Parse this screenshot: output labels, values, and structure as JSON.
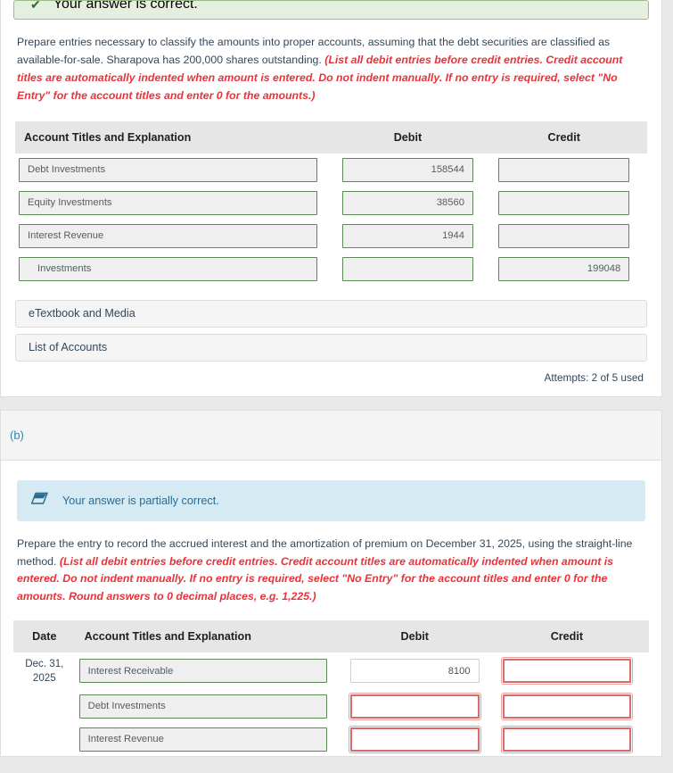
{
  "section_a": {
    "status_banner": {
      "icon": "check-icon",
      "text": "Your answer is correct."
    },
    "prompt": {
      "plain": "Prepare entries necessary to classify the amounts into proper accounts, assuming that the debt securities are classified as available-for-sale. Sharapova has 200,000 shares outstanding. ",
      "italic_red": "(List all debit entries before credit entries. Credit account titles are automatically indented when amount is entered. Do not indent manually. If no entry is required, select \"No Entry\" for the account titles and enter 0 for the amounts.)"
    },
    "table": {
      "headers": {
        "account": "Account Titles and Explanation",
        "debit": "Debit",
        "credit": "Credit"
      },
      "rows": [
        {
          "account": "Debt Investments",
          "indent": false,
          "debit": "158544",
          "credit": ""
        },
        {
          "account": "Equity Investments",
          "indent": false,
          "debit": "38560",
          "credit": ""
        },
        {
          "account": "Interest Revenue",
          "indent": false,
          "debit": "1944",
          "credit": ""
        },
        {
          "account": "Investments",
          "indent": true,
          "debit": "",
          "credit": "199048"
        }
      ]
    },
    "buttons": {
      "etextbook": "eTextbook and Media",
      "list_of_accounts": "List of Accounts"
    },
    "attempts": "Attempts: 2 of 5 used"
  },
  "section_b": {
    "label": "(b)",
    "status_banner": {
      "icon": "partial-icon",
      "text": "Your answer is partially correct."
    },
    "prompt": {
      "plain": "Prepare the entry to record the accrued interest and the amortization of premium on December 31, 2025, using the straight-line method. ",
      "italic_red": "(List all debit entries before credit entries. Credit account titles are automatically indented when amount is entered. Do not indent manually. If no entry is required, select \"No Entry\" for the account titles and enter 0 for the amounts. Round answers to 0 decimal places, e.g. 1,225.)"
    },
    "table": {
      "headers": {
        "date": "Date",
        "account": "Account Titles and Explanation",
        "debit": "Debit",
        "credit": "Credit"
      },
      "rows": [
        {
          "date": "Dec. 31, 2025",
          "account": "Interest Receivable",
          "debit": "8100",
          "credit": "",
          "debit_state": "white",
          "credit_state": "error"
        },
        {
          "date": "",
          "account": "Debt Investments",
          "debit": "",
          "credit": "",
          "debit_state": "error",
          "credit_state": "error"
        },
        {
          "date": "",
          "account": "Interest Revenue",
          "debit": "",
          "credit": "",
          "debit_state": "error",
          "credit_state": "error"
        }
      ]
    }
  },
  "colors": {
    "correct_bg": "#e4efdf",
    "correct_border": "#9dbb88",
    "partial_bg": "#d5eaf3",
    "field_border_green": "#5c8a55",
    "field_border_error": "#d96a6a",
    "accent_blue": "#2789b5",
    "instruction_red": "#e8333a"
  }
}
